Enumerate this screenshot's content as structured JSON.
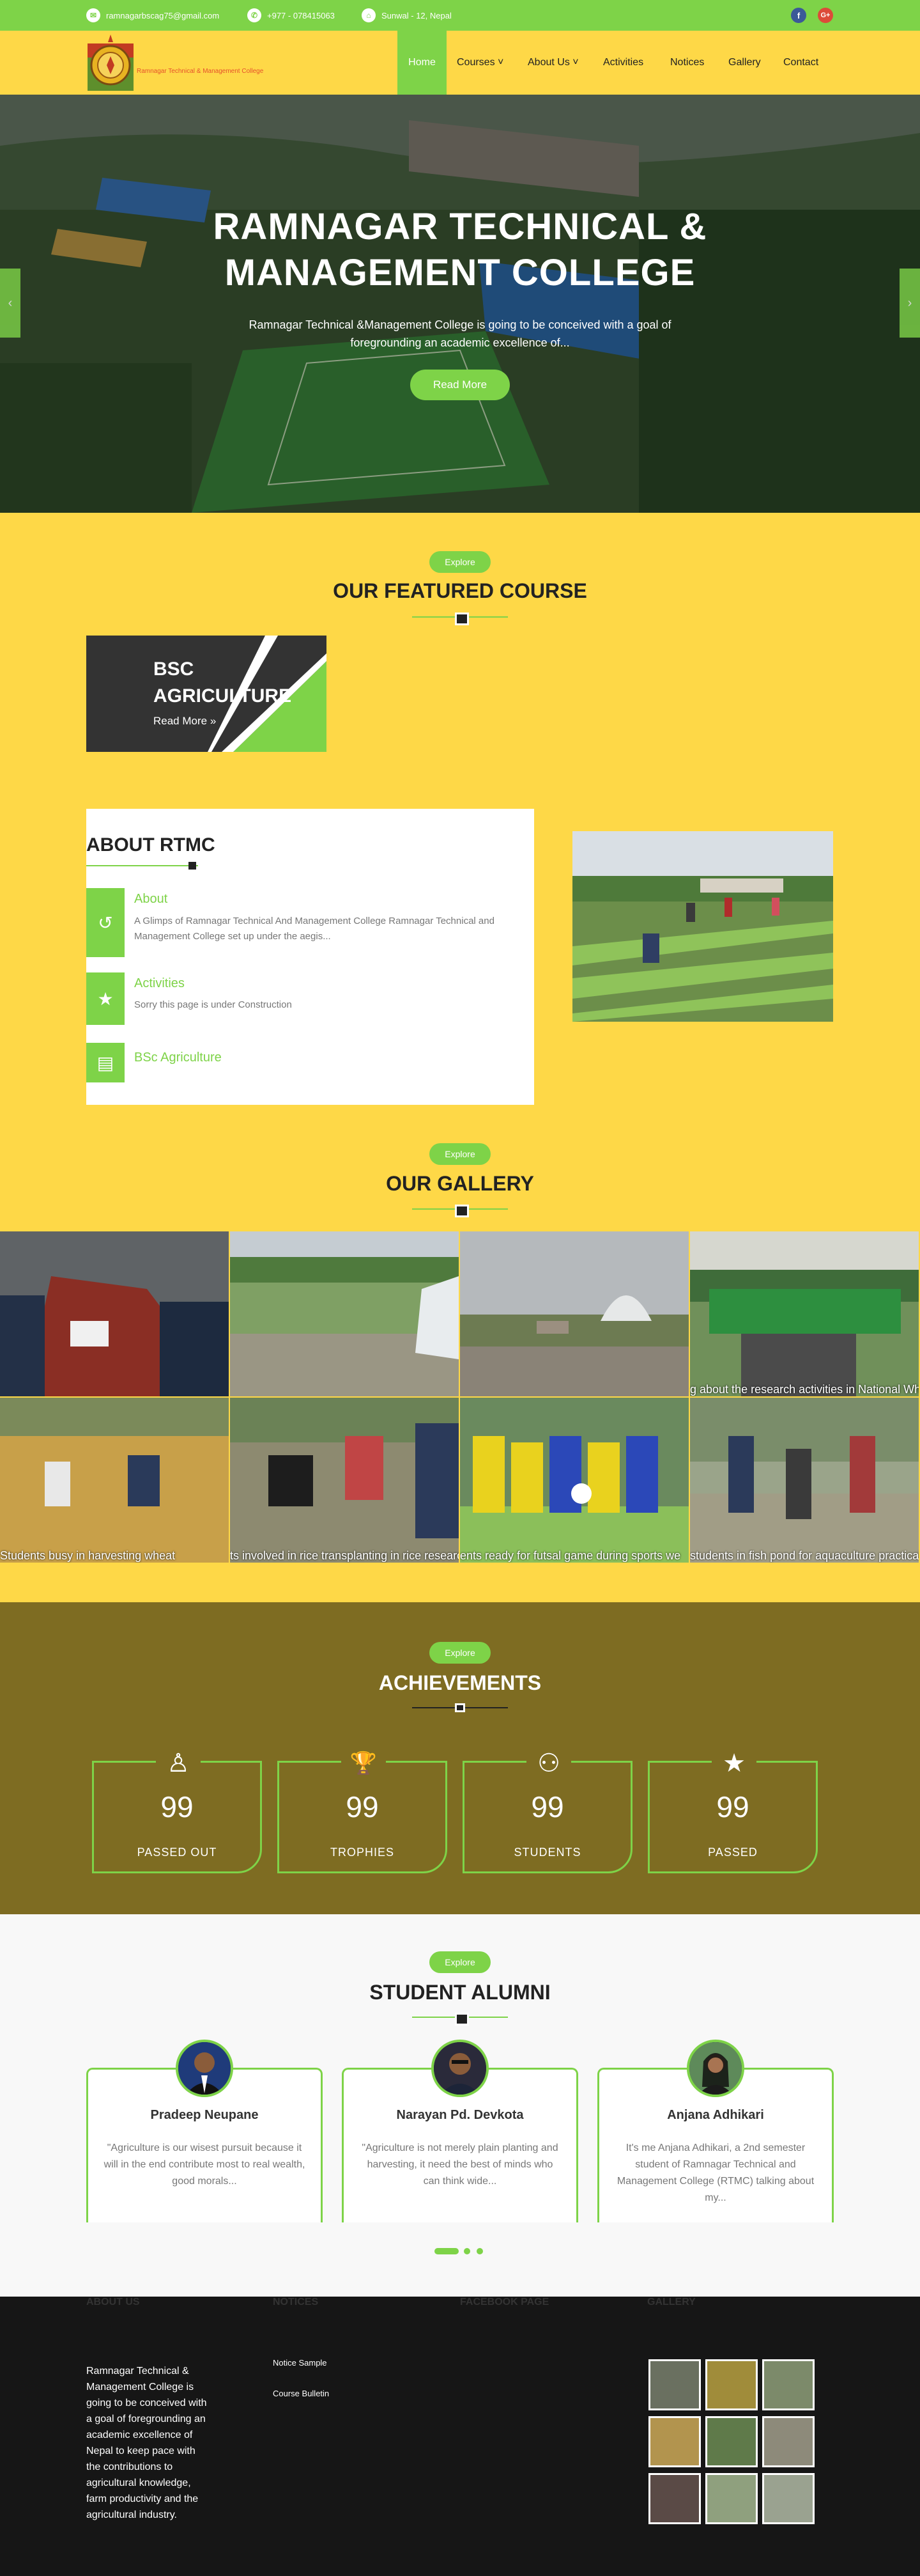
{
  "topbar": {
    "email": "ramnagarbscag75@gmail.com",
    "phone": "+977 - 078415063",
    "address": "Sunwal - 12, Nepal"
  },
  "brand": {
    "logo_text": "Ramnagar Technical & Management College"
  },
  "nav": {
    "items": [
      {
        "label": "Home",
        "active": true
      },
      {
        "label": "Courses ˅"
      },
      {
        "label": "About Us ˅"
      },
      {
        "label": "Activities"
      },
      {
        "label": "Notices"
      },
      {
        "label": "Gallery"
      },
      {
        "label": "Contact"
      }
    ]
  },
  "hero": {
    "title_line1": "RAMNAGAR TECHNICAL &",
    "title_line2": "MANAGEMENT COLLEGE",
    "text_line1": "Ramnagar Technical &Management College is going to be conceived with a goal of",
    "text_line2": "foregrounding an academic excellence of...",
    "button": "Read More",
    "prev": "‹",
    "next": "›"
  },
  "featured": {
    "pill": "Explore",
    "title": "OUR FEATURED COURSE",
    "course_line1": "BSC",
    "course_line2": "AGRICULTURE",
    "course_link": "Read More »"
  },
  "about": {
    "title": "ABOUT RTMC",
    "rows": [
      {
        "icon": "history-icon",
        "glyph": "↺",
        "heading": "About",
        "text": "A Glimps of Ramnagar Technical And Management College Ramnagar Technical and Management College set up under the aegis..."
      },
      {
        "icon": "star-icon",
        "glyph": "★",
        "heading": "Activities",
        "text": "Sorry this page is under Construction"
      },
      {
        "icon": "book-icon",
        "glyph": "▤",
        "heading": "BSc Agriculture",
        "text": ""
      }
    ]
  },
  "gallery": {
    "pill": "Explore",
    "title": "OUR GALLERY",
    "captions": [
      "",
      "",
      "",
      "g about the research activities in National Wheat Research Program",
      "Students busy in harvesting wheat",
      "ts involved in rice transplanting in rice research",
      "ents ready for futsal game during sports we",
      "students in fish pond for aquaculture practical"
    ]
  },
  "achievements": {
    "pill": "Explore",
    "title": "ACHIEVEMENTS",
    "items": [
      {
        "icon": "person-raised-icon",
        "glyph": "♙",
        "value": "99",
        "label": "PASSED OUT"
      },
      {
        "icon": "trophy-icon",
        "glyph": "🏆",
        "value": "99",
        "label": "TROPHIES"
      },
      {
        "icon": "user-icon",
        "glyph": "⚇",
        "value": "99",
        "label": "STUDENTS"
      },
      {
        "icon": "star-icon",
        "glyph": "★",
        "value": "99",
        "label": "PASSED"
      }
    ]
  },
  "alumni": {
    "pill": "Explore",
    "title": "STUDENT ALUMNI",
    "items": [
      {
        "name": "Pradeep Neupane",
        "quote": "\"Agriculture is our wisest pursuit because it will in the end contribute most to real wealth, good morals..."
      },
      {
        "name": "Narayan Pd. Devkota",
        "quote": "\"Agriculture is not merely plain planting and harvesting, it need the best of minds who can think wide..."
      },
      {
        "name": "Anjana Adhikari",
        "quote": "It's me Anjana Adhikari, a 2nd semester student of Ramnagar Technical and Management College (RTMC) talking about my..."
      }
    ]
  },
  "footer": {
    "about_title": "ABOUT US",
    "about_text": "Ramnagar Technical & Management College is going to be conceived with a goal of foregrounding an academic excellence of Nepal to keep pace with the contributions to agricultural knowledge, farm productivity and the agricultural industry.",
    "notices_title": "NOTICES",
    "notices": [
      "Notice Sample",
      "Course Bulletin"
    ],
    "facebook_title": "FACEBOOK PAGE",
    "gallery_title": "GALLERY"
  },
  "colors": {
    "accent": "#7ed348",
    "brand_yellow": "#fed847",
    "achievements_bg": "#7e6c22",
    "footer_bg": "#161616"
  }
}
